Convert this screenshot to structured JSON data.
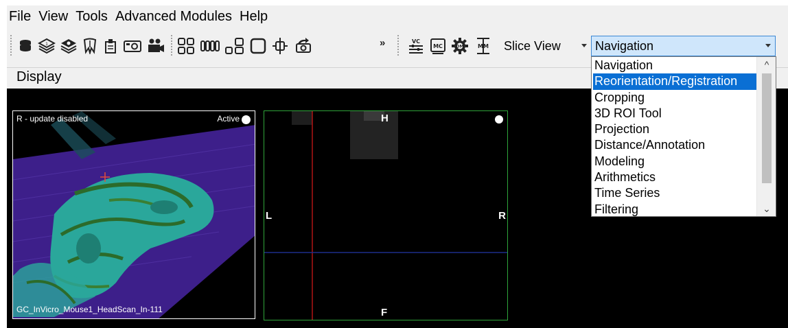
{
  "menu": {
    "items": [
      "File",
      "View",
      "Tools",
      "Advanced Modules",
      "Help"
    ]
  },
  "toolbar": {
    "icons": [
      "database-icon",
      "layers-1-icon",
      "layers-2-icon",
      "tooth-icon",
      "document-clip-icon",
      "camera-icon",
      "video-camera-icon",
      "grid-4-icon",
      "column-layout-icon",
      "mixed-layout-icon",
      "single-view-icon",
      "crosshair-icon",
      "snapshot-icon"
    ],
    "overflow_label": "»",
    "tool_icons": [
      {
        "name": "vc-icon",
        "label": "VC"
      },
      {
        "name": "mc-icon",
        "label": "MC"
      },
      {
        "name": "gear-icon",
        "label": "DM"
      },
      {
        "name": "mm-icon",
        "label": "MM"
      }
    ],
    "slice_view_value": "Slice View",
    "module_value": "Navigation"
  },
  "display": {
    "header_label": "Display"
  },
  "view_3d": {
    "status": "R - update disabled",
    "active_label": "Active",
    "dataset_name": "GC_InVicro_Mouse1_HeadScan_In-111"
  },
  "view_slice": {
    "orientation": {
      "top": "H",
      "left": "L",
      "right": "R",
      "bottom": "F"
    }
  },
  "dropdown": {
    "selected": "Reorientation/Registration",
    "items": [
      "Navigation",
      "Reorientation/Registration",
      "Cropping",
      "3D ROI Tool",
      "Projection",
      "Distance/Annotation",
      "Modeling",
      "Arithmetics",
      "Time Series",
      "Filtering"
    ],
    "scroll_up": "^",
    "scroll_down": "⌄"
  },
  "colors": {
    "selection": "#0a6fd4",
    "combo_highlight": "#cfe6fb",
    "slice_border": "#2fa53a",
    "volume_teal": "#2aa79b",
    "volume_purple": "#3d1f8a"
  }
}
